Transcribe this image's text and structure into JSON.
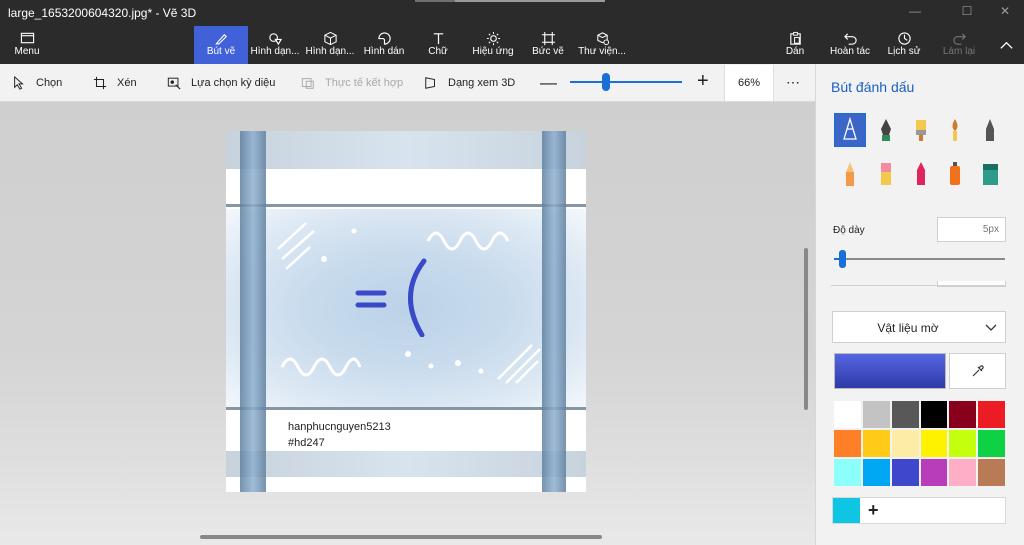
{
  "window": {
    "title": "large_1653200604320.jpg* - Vẽ 3D",
    "min": "—",
    "max": "☐",
    "close": "✕"
  },
  "ribbon": {
    "menu": "Menu",
    "tabs": [
      {
        "label": "Bút vẽ",
        "icon": "brush-icon"
      },
      {
        "label": "Hình dạn...",
        "icon": "shapes-2d-icon"
      },
      {
        "label": "Hình dạn...",
        "icon": "shapes-3d-icon"
      },
      {
        "label": "Hình dán",
        "icon": "sticker-icon"
      },
      {
        "label": "Chữ",
        "icon": "text-icon"
      },
      {
        "label": "Hiệu ứng",
        "icon": "effects-icon"
      },
      {
        "label": "Bức vẽ",
        "icon": "canvas-icon"
      },
      {
        "label": "Thư viện...",
        "icon": "library-icon"
      }
    ],
    "right": [
      {
        "label": "Dán",
        "icon": "paste-icon"
      },
      {
        "label": "Hoàn tác",
        "icon": "undo-icon"
      },
      {
        "label": "Lịch sử",
        "icon": "history-icon"
      },
      {
        "label": "Làm lại",
        "icon": "redo-icon"
      }
    ]
  },
  "toolbar": {
    "select": "Chọn",
    "crop": "Xén",
    "magic": "Lựa chọn kỳ diệu",
    "mixed": "Thực tế kết hợp",
    "view3d": "Dạng xem 3D",
    "zoom_minus": "—",
    "zoom_plus": "+",
    "zoom": "66%",
    "more": "⋯",
    "zoom_level": 0.3
  },
  "canvas": {
    "line1": "hanphucnguyen5213",
    "line2": "#hd247",
    "emoticon": "=("
  },
  "panel": {
    "title": "Bút đánh dấu",
    "thickness_label": "Độ dày",
    "thickness_value": "5px",
    "thickness_level": 0.03,
    "material": "Vật liệu mờ",
    "palette": [
      "#ffffff",
      "#c3c3c3",
      "#585858",
      "#000000",
      "#88001b",
      "#ec1c24",
      "#ff7f27",
      "#ffca18",
      "#fdeca6",
      "#fff200",
      "#c4ff0e",
      "#0ed145",
      "#8cfffb",
      "#00a8f3",
      "#3f48cc",
      "#b83dba",
      "#ffaec8",
      "#b97a56"
    ],
    "custom_color": "#0ec5e3",
    "add": "+"
  }
}
